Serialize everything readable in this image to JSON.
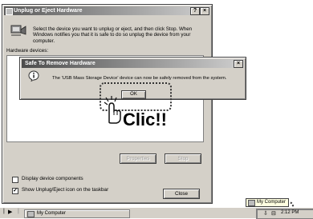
{
  "unplug": {
    "title": "Unplug or Eject Hardware",
    "help": "?",
    "close": "×",
    "description": "Select the device you want to unplug or eject, and then click Stop. When Windows notifies you that it is safe to do so unplug the device from your computer.",
    "hardware_label": "Hardware devices:",
    "properties_label": "Properties",
    "stop_label": "Stop",
    "display_components_label": "Display device components",
    "show_icon_label": "Show Unplug/Eject icon on the taskbar",
    "close_label": "Close"
  },
  "dialog": {
    "title": "Safe To Remove Hardware",
    "close": "×",
    "message": "The 'USB Mass Storage Device' device can now be safely removed from the system.",
    "ok_label": "OK"
  },
  "annotation": {
    "click_text": "Clic!!"
  },
  "taskbar": {
    "task_label": "My Computer",
    "time": "2:12 PM",
    "tooltip": "My Computer"
  }
}
